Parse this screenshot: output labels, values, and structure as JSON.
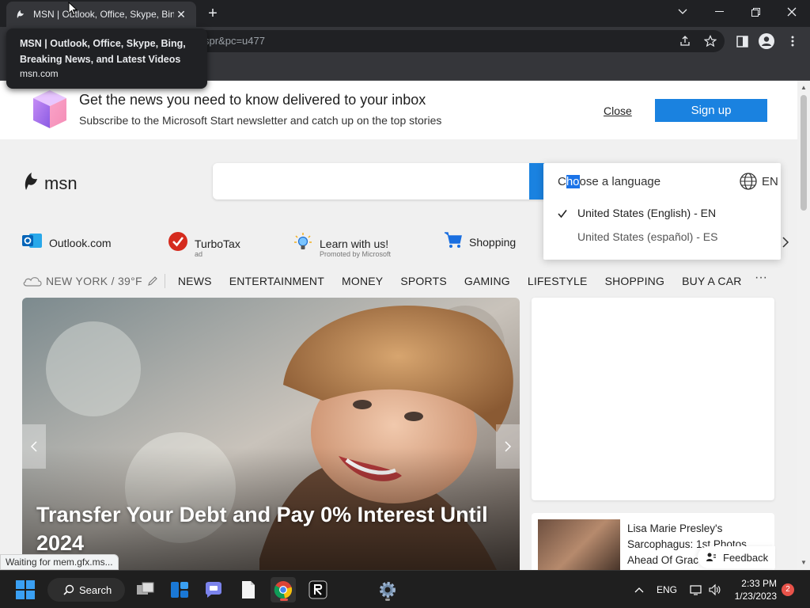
{
  "browser": {
    "tab_title": "MSN | Outlook, Office, Skype, Bing, Breaking News, and Latest Videos",
    "tab_title_visible": "MSN | Outlook, Office, Skype, Bin",
    "address_partial": "spr&pc=u477",
    "tooltip": {
      "title": "MSN | Outlook, Office, Skype, Bing, Breaking News, and Latest Videos",
      "url": "msn.com"
    },
    "status_text": "Waiting for mem.gfx.ms..."
  },
  "banner": {
    "title": "Get the news you need to know delivered to your inbox",
    "subtitle": "Subscribe to the Microsoft Start newsletter and catch up on the top stories",
    "close_label": "Close",
    "signup_label": "Sign up"
  },
  "header": {
    "logo_text": "msn"
  },
  "language_popup": {
    "label": "Choose a language",
    "label_parts": [
      "C",
      "ho",
      "ose a language"
    ],
    "code": "EN",
    "options": [
      {
        "label": "United States (English) - EN",
        "selected": true
      },
      {
        "label": "United States (español) - ES",
        "selected": false
      }
    ]
  },
  "quicklinks": [
    {
      "label": "Outlook.com",
      "sub": ""
    },
    {
      "label": "TurboTax",
      "sub": "ad"
    },
    {
      "label": "Learn with us!",
      "sub": "Promoted by Microsoft"
    },
    {
      "label": "Shopping",
      "sub": ""
    }
  ],
  "nav": {
    "weather": "NEW YORK / 39°F",
    "items": [
      "NEWS",
      "ENTERTAINMENT",
      "MONEY",
      "SPORTS",
      "GAMING",
      "LIFESTYLE",
      "SHOPPING",
      "BUY A CAR"
    ],
    "more": "···"
  },
  "hero": {
    "title": "Transfer Your Debt and Pay 0% Interest Until 2024"
  },
  "story": {
    "title": "Lisa Marie Presley's Sarcophagus: 1st Photos Ahead Of Grac"
  },
  "feedback_label": "Feedback",
  "taskbar": {
    "search_label": "Search",
    "language": "ENG",
    "time": "2:33 PM",
    "date": "1/23/2023",
    "notification_count": "2"
  },
  "colors": {
    "accent_blue": "#1a82e0",
    "chrome_dark": "#202124",
    "chrome_toolbar": "#35363a",
    "taskbar": "#1f1f1f",
    "notification_red": "#e8534a"
  }
}
